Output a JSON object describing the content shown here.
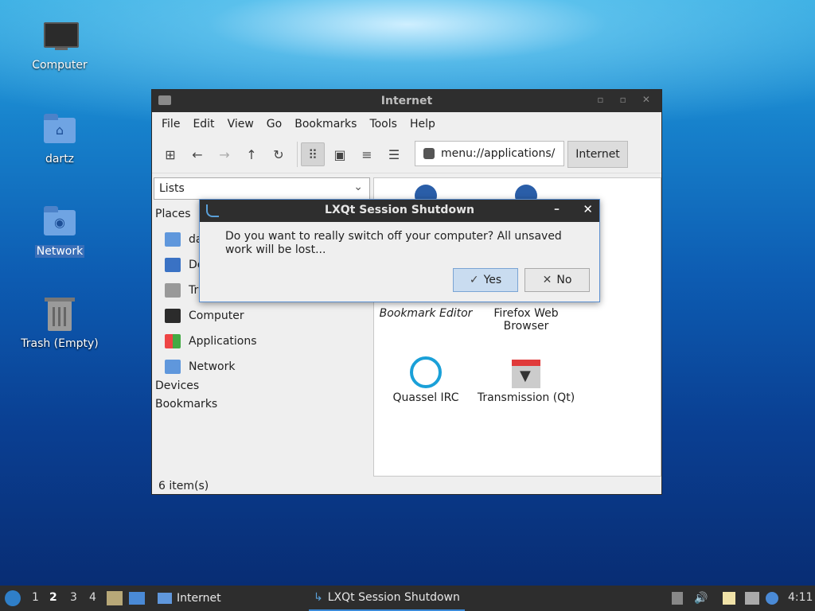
{
  "desktop": {
    "icons": [
      {
        "label": "Computer"
      },
      {
        "label": "dartz"
      },
      {
        "label": "Network"
      },
      {
        "label": "Trash (Empty)"
      }
    ]
  },
  "window": {
    "title": "Internet",
    "menu": [
      "File",
      "Edit",
      "View",
      "Go",
      "Bookmarks",
      "Tools",
      "Help"
    ],
    "address": "menu://applications/",
    "path_button": "Internet",
    "side_mode": "Lists",
    "places_header": "Places",
    "places": [
      "da",
      "De",
      "Tr",
      "Computer",
      "Applications",
      "Network"
    ],
    "devices_header": "Devices",
    "bookmarks_header": "Bookmarks",
    "apps": [
      "Bookmark Editor",
      "Firefox Web Browser",
      "Quassel IRC",
      "Transmission (Qt)"
    ],
    "status": "6 item(s)"
  },
  "dialog": {
    "title": "LXQt Session Shutdown",
    "message": "Do you want to really switch off your computer? All unsaved work will be lost...",
    "yes_label": "Yes",
    "no_label": "No"
  },
  "taskbar": {
    "workspaces": [
      "1",
      "2",
      "3",
      "4"
    ],
    "current_workspace": "2",
    "tasks": [
      "Internet",
      "LXQt Session Shutdown"
    ],
    "clock": "4:11"
  }
}
